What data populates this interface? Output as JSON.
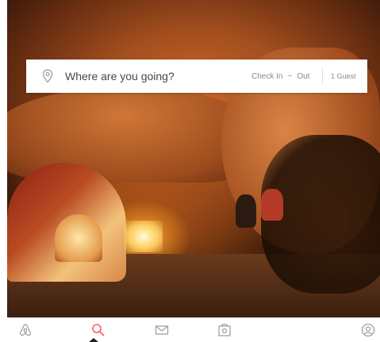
{
  "search": {
    "destination_placeholder": "Where are you going?",
    "check_in_label": "Check In",
    "date_separator": "~",
    "check_out_label": "Out",
    "guests_label": "1 Guest"
  },
  "tabbar": {
    "active_tab": "search",
    "icons": [
      "airbnb-logo-icon",
      "search-icon",
      "messages-icon",
      "trips-icon",
      "profile-icon"
    ],
    "active_color": "#ff5a5f",
    "inactive_color": "#9b9b9b"
  },
  "colors": {
    "brand": "#ff5a5f",
    "text": "#484848",
    "muted": "#8a8a8a"
  }
}
